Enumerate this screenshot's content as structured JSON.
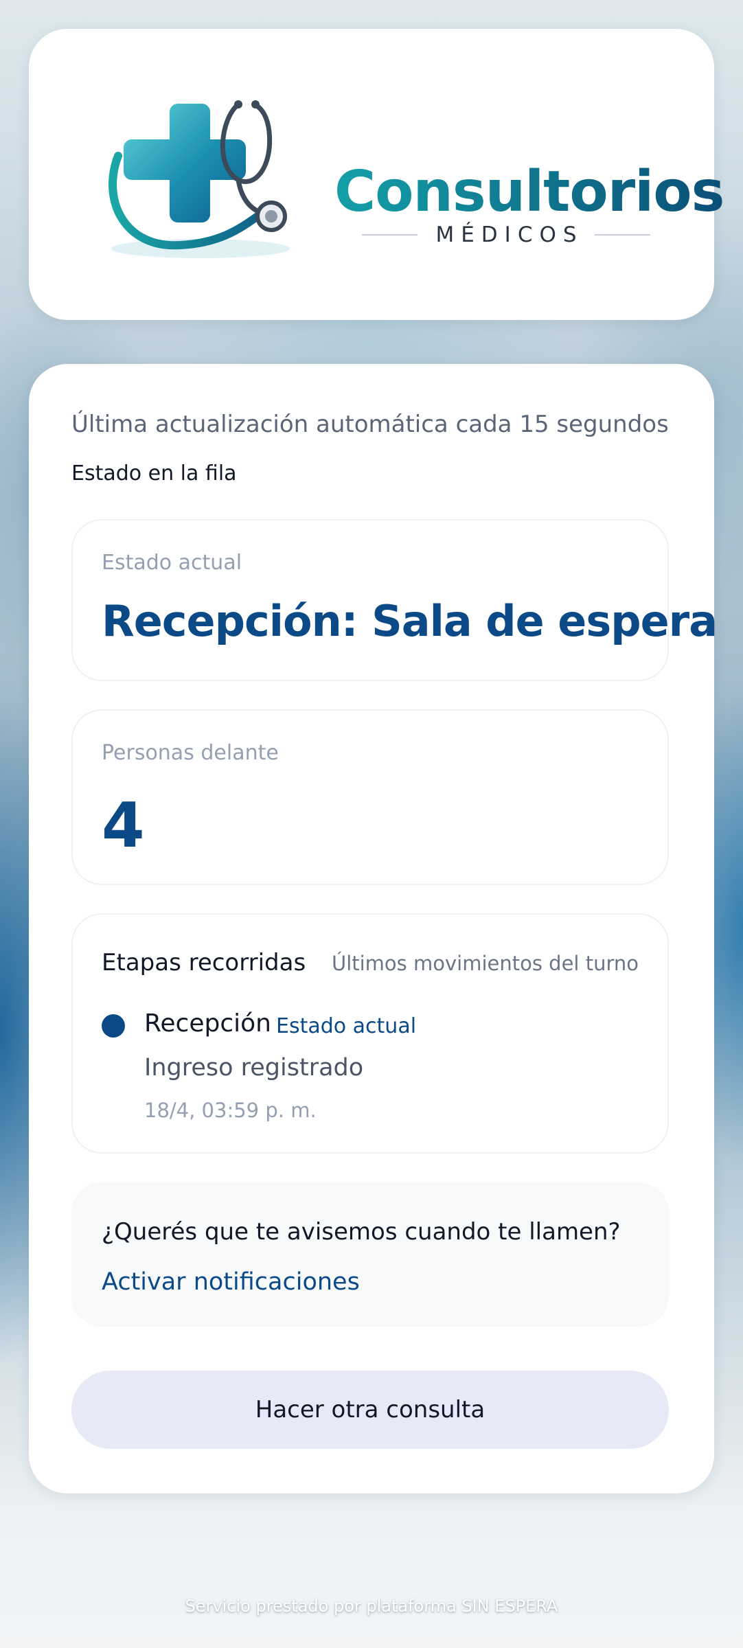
{
  "brand": {
    "name": "Consultorios",
    "subtitle": "MÉDICOS",
    "colors": {
      "teal": "#14a0a8",
      "navy": "#0b4a86"
    }
  },
  "header": {
    "update_text": "Última actualización automática cada 15 segundos",
    "queue_label": "Estado en la fila"
  },
  "status": {
    "label": "Estado actual",
    "value": "Recepción: Sala de espera"
  },
  "ahead": {
    "label": "Personas delante",
    "value": "4"
  },
  "stages": {
    "title": "Etapas recorridas",
    "subtitle": "Últimos movimientos del turno",
    "items": [
      {
        "name": "Recepción",
        "tag": "Estado actual",
        "description": "Ingreso registrado",
        "time": "18/4, 03:59 p. m."
      }
    ]
  },
  "notify": {
    "question": "¿Querés que te avisemos cuando te llamen?",
    "action_label": "Activar notificaciones"
  },
  "actions": {
    "again_label": "Hacer otra consulta"
  },
  "footer": {
    "text": "Servicio prestado por plataforma SIN ESPERA"
  }
}
